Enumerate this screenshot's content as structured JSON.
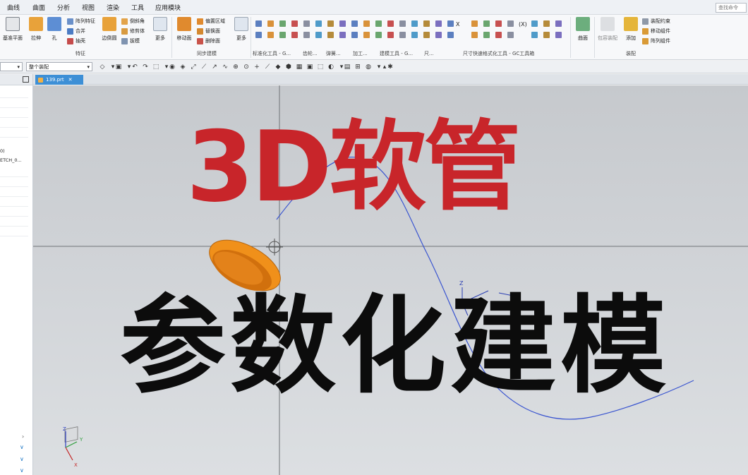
{
  "menubar": {
    "items": [
      "曲线",
      "曲面",
      "分析",
      "视图",
      "渲染",
      "工具",
      "应用模块"
    ],
    "command_finder_placeholder": "查找命令"
  },
  "ribbon": {
    "feature_group": {
      "datum_plane": "基准平面",
      "extrude": "拉伸",
      "hole": "孔",
      "pattern_feature": "阵列特征",
      "unite": "合并",
      "shell": "抽壳",
      "edge_blend": "边倒圆",
      "chamfer": "倒斜角",
      "trim_body": "修剪体",
      "draft": "拔模",
      "more": "更多",
      "label": "特征"
    },
    "sync_group": {
      "move_face": "移动面",
      "offset_region": "偏置区域",
      "replace_face": "替换面",
      "delete_face": "删除面",
      "more": "更多",
      "label": "同步建模"
    },
    "group_labels": [
      "标准化工具 - G...",
      "齿轮...",
      "弹簧...",
      "加工...",
      "建模工具 - G...",
      "尺...",
      "尺寸快速格式化工具 - GC工具箱"
    ],
    "surface_label": "曲面",
    "assembly_group": {
      "new_component": "包容装配",
      "add": "添加",
      "assembly_constraints": "装配约束",
      "move_component": "移动组件",
      "pattern_component": "阵列组件",
      "label": "装配"
    },
    "x_label": "X",
    "bracket_x_label": "(X)"
  },
  "selection_bar": {
    "filter_value": "",
    "scope_value": "整个装配"
  },
  "navigator": {
    "partial_lines": [
      "0)",
      "ETCH_0..."
    ]
  },
  "tab": {
    "file_name": "139.prt"
  },
  "viewport": {
    "wcs_labels": {
      "z": "Z",
      "y": "Y"
    },
    "triad_labels": {
      "z": "Z",
      "y": "Y",
      "x": "X"
    }
  },
  "overlay": {
    "line1": "3D软管",
    "line2": "参数化建模"
  },
  "colors": {
    "headline_red": "#c8252a",
    "headline_black": "#0c0c0c",
    "part_orange": "#f0901a",
    "curve_blue": "#3a55d0",
    "tab_blue": "#3d8fd6"
  }
}
